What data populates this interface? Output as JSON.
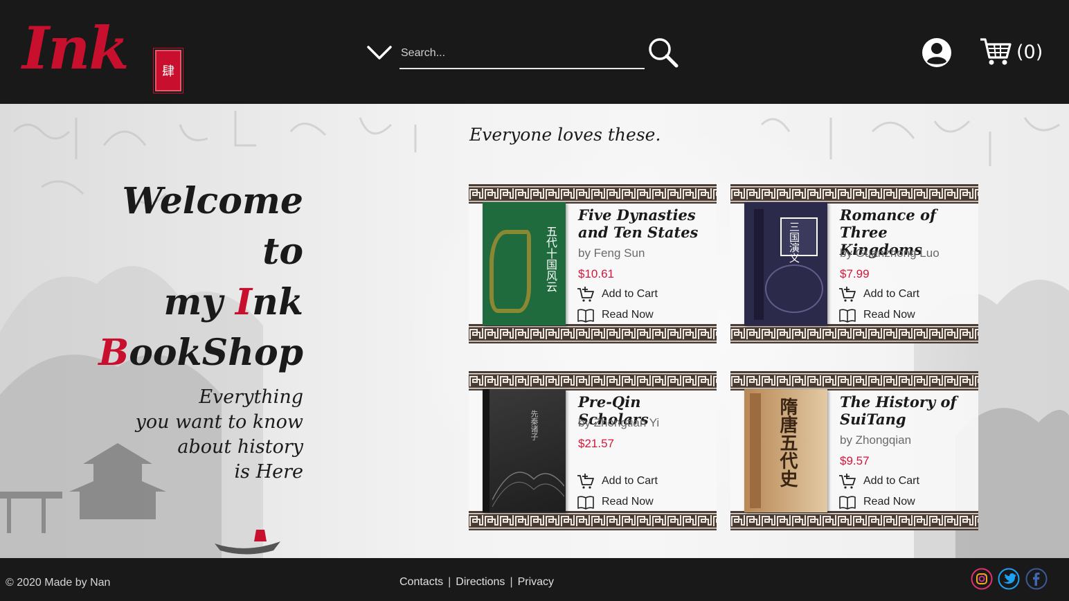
{
  "header": {
    "logo_text": "Ink",
    "logo_seal_char": "肆",
    "search_placeholder": "Search...",
    "cart_count": "(0)"
  },
  "hero": {
    "welcome_line1": "Welcome",
    "welcome_line2": "to",
    "welcome_line3_pre": "my ",
    "welcome_line3_red": "I",
    "welcome_line3_post": "nk",
    "welcome_line4_red": "B",
    "welcome_line4_post": "ookShop",
    "tagline_1": "Everything",
    "tagline_2": "you want to know",
    "tagline_3": "about history",
    "tagline_4": "is Here"
  },
  "featured": {
    "title": "Everyone loves these.",
    "books": [
      {
        "title_1": "Five Dynasties",
        "title_2": "and Ten States",
        "author": "by Feng Sun",
        "price": "$10.61",
        "add_to_cart": "Add to Cart",
        "read_now": "Read Now",
        "cover_color": "#1f6b3e",
        "cover_text": "五代十国风云"
      },
      {
        "title_1": "Romance of Three",
        "title_2": "Kingdoms",
        "author": "by Guanzhong Luo",
        "price": "$7.99",
        "add_to_cart": "Add to Cart",
        "read_now": "Read Now",
        "cover_color": "#2b2a4a",
        "cover_text": "三国演义"
      },
      {
        "title_1": "Pre-Qin Scholars",
        "title_2": "",
        "author": "by Zhongtian Yi",
        "price": "$21.57",
        "add_to_cart": "Add to Cart",
        "read_now": "Read Now",
        "cover_color": "#2a2a2a",
        "cover_text": "先秦诸子"
      },
      {
        "title_1": "The History of",
        "title_2": "SuiTang",
        "author": "by Zhongqian",
        "price": "$9.57",
        "add_to_cart": "Add to Cart",
        "read_now": "Read Now",
        "cover_color": "#c9a57a",
        "cover_text": "隋唐五代史"
      }
    ]
  },
  "footer": {
    "copyright": "© 2020 Made by Nan",
    "links": [
      "Contacts",
      "Directions",
      "Privacy"
    ],
    "separator": "|"
  },
  "colors": {
    "accent_red": "#c8102e",
    "price_red": "#d6153a",
    "bar_bg": "#1a1919"
  },
  "icons": [
    "chevron-down-icon",
    "search-icon",
    "account-icon",
    "cart-icon",
    "add-cart-icon",
    "book-open-icon",
    "instagram-icon",
    "twitter-icon",
    "facebook-icon"
  ]
}
